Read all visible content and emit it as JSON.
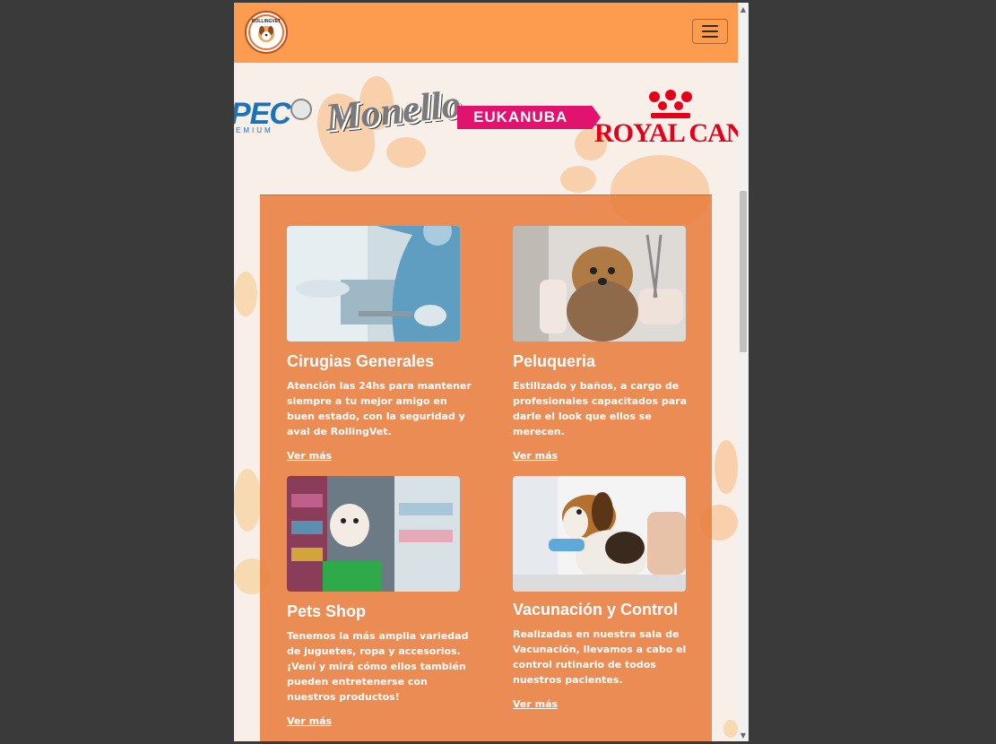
{
  "navbar": {
    "brand_name": "ROLLINGVET",
    "brand_sub": "CLINICA VETERINARIA",
    "menu_icon": "hamburger-icon"
  },
  "brands": {
    "pec": "PEC",
    "pec_sub": "EMIUM",
    "monello": "Monello",
    "eukanuba": "EUKANUBA",
    "royal_canin": "ROYAL CANIN"
  },
  "services": [
    {
      "title": "Cirugias Generales",
      "text": "Atención las 24hs para mantener siempre a tu mejor amigo en buen estado, con la seguridad y aval de RollingVet.",
      "link": "Ver más",
      "image": "surgery-photo"
    },
    {
      "title": "Peluqueria",
      "text": "Estilizado y baños, a cargo de profesionales capacitados para darle el look que ellos se merecen.",
      "link": "Ver más",
      "image": "grooming-photo"
    },
    {
      "title": "Pets Shop",
      "text": "Tenemos la más amplia variedad de juguetes, ropa y accesorios. ¡Vení y mirá cómo ellos también pueden entretenerse con nuestros productos!",
      "link": "Ver más",
      "image": "pet-shop-photo"
    },
    {
      "title": "Vacunación y Control",
      "text": "Realizadas en nuestra sala de Vacunación, llevamos a cabo el control rutinario de todos nuestros pacientes.",
      "link": "Ver más",
      "image": "vaccination-photo"
    }
  ],
  "colors": {
    "navbar": "#fd9b4f",
    "page_bg": "#f8efe9",
    "services_bg": "#e87e40",
    "paw": "#f8c591"
  }
}
